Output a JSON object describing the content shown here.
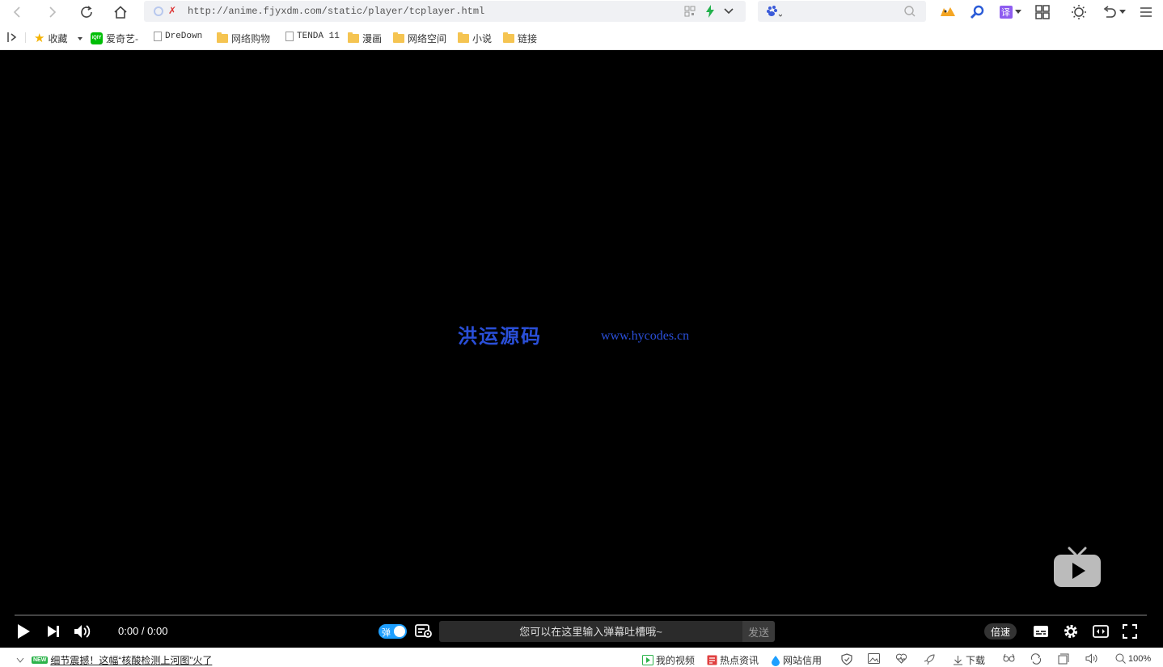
{
  "browser": {
    "url": "http://anime.fjyxdm.com/static/player/tcplayer.html",
    "search_placeholder": "",
    "icons": [
      "back-icon",
      "forward-icon",
      "refresh-icon",
      "home-icon",
      "qr-icon",
      "lightning-icon",
      "chevron-down-icon",
      "baidu-paw-icon",
      "search-icon",
      "extension-icon",
      "magnifier-icon",
      "translate-icon",
      "apps-grid-icon",
      "brightness-icon",
      "undo-icon",
      "menu-icon"
    ]
  },
  "bookmarks": {
    "favorites_label": "收藏",
    "items": [
      {
        "label": "爱奇艺-",
        "type": "iqiyi"
      },
      {
        "label": "DreDown",
        "type": "page"
      },
      {
        "label": "网络购物",
        "type": "folder"
      },
      {
        "label": "TENDA 11",
        "type": "page"
      },
      {
        "label": "漫画",
        "type": "folder"
      },
      {
        "label": "网络空间",
        "type": "folder"
      },
      {
        "label": "小说",
        "type": "folder"
      },
      {
        "label": "链接",
        "type": "folder"
      }
    ]
  },
  "player": {
    "watermark_title": "洪运源码",
    "watermark_url": "www.hycodes.cn",
    "time": "0:00 / 0:00",
    "danmu_toggle_label": "弹",
    "danmu_placeholder": "您可以在这里输入弹幕吐槽哦~",
    "send_label": "发送",
    "speed_label": "倍速",
    "progress": 0
  },
  "statusbar": {
    "news_badge": "NEW",
    "news_text": "细节震撼！这幅“核酸检测上河图”火了",
    "my_video": "我的视频",
    "hot_news": "热点资讯",
    "site_credit": "网站信用",
    "download": "下载",
    "zoom": "100%"
  },
  "colors": {
    "accent": "#1e9fff",
    "watermark": "#2a4fd8",
    "player_bg": "#000000"
  }
}
